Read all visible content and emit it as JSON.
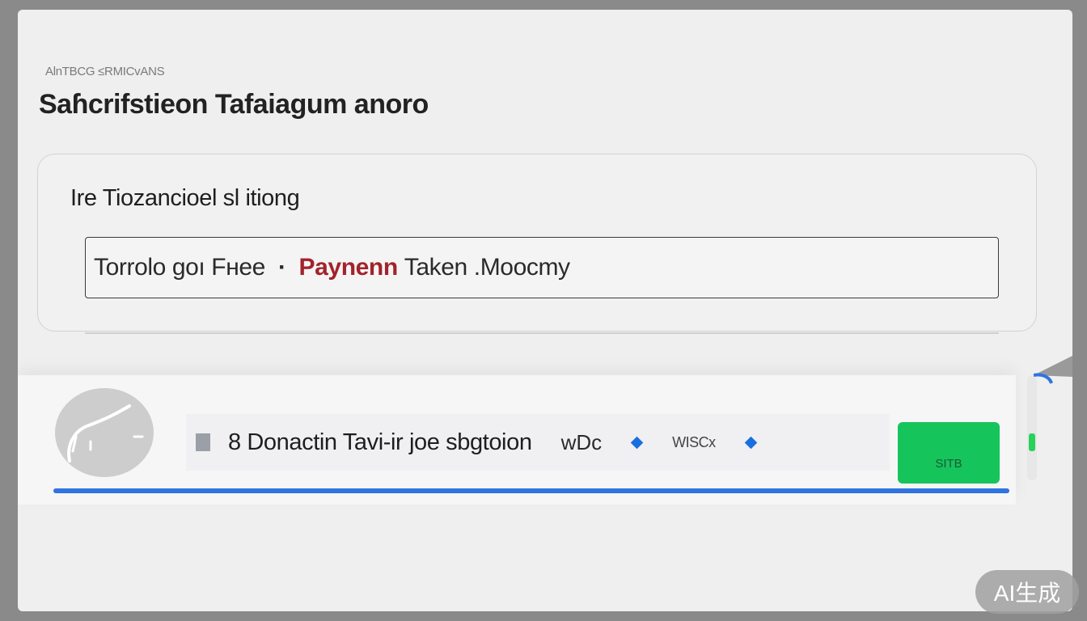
{
  "header": {
    "breadcrumb": "AlnTBCG ≤RMICvANS",
    "title": "Saɦcrifstieon Tafaiagum anoro"
  },
  "card": {
    "heading": "Ire Tiozancioel sl itiong",
    "field": {
      "prefix": "Torrolo goı Fнee",
      "separator": "·",
      "highlight": "Paynenn",
      "suffix": "Taken .Moocmy"
    }
  },
  "list": {
    "row": {
      "label": "8 Donactin Tavi-ir joe sbgtoion",
      "meta": "wDc",
      "meta2": "WISCx"
    },
    "button_label": "SITB",
    "progress": 1.0
  },
  "watermark": "AI生成",
  "colors": {
    "accent": "#2f74e0",
    "highlight": "#a3222b",
    "success": "#16c45c"
  },
  "icons": {
    "avatar": "avatar-icon",
    "row_icon": "document-icon",
    "dot": "diamond-icon"
  }
}
